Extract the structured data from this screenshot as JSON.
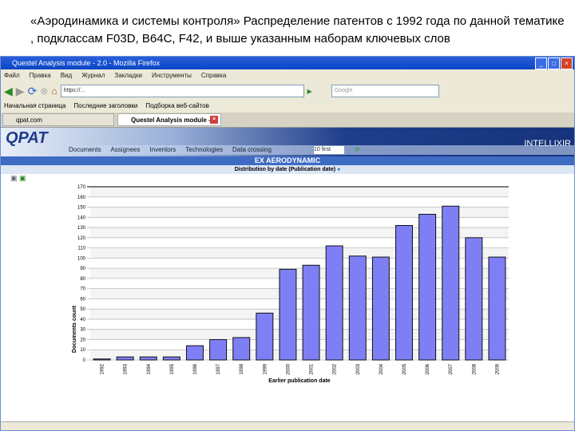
{
  "caption": "«Аэродинамика и системы контроля» Распределение патентов с 1992 года  по данной тематике , подклассам F03D, B64C, F42,  и выше указанным наборам ключевых слов",
  "browser": {
    "title": "Questel Analysis module - 2.0 - Mozilla Firefox",
    "menu": [
      "Файл",
      "Правка",
      "Вид",
      "Журнал",
      "Закладки",
      "Инструменты",
      "Справка"
    ],
    "url": "https://...",
    "search_placeholder": "Google",
    "bookmarks": [
      "Начальная страница",
      "Последние заголовки",
      "Подборка веб-сайтов"
    ],
    "tabs": [
      {
        "label": "qpat.com"
      },
      {
        "label": "Questel Analysis module - 2.0"
      }
    ]
  },
  "app": {
    "logo": "QPAT",
    "brand": "INTELLIXIR",
    "nav": [
      "Documents",
      "Assignees",
      "Inventors",
      "Technologies",
      "Data crossing"
    ],
    "select_value": "10 first",
    "section_title": "EX AERODYNAMIC",
    "subtitle": "Distribution by date (Publication date)"
  },
  "chart_data": {
    "type": "bar",
    "title": "Distribution by date (Publication date)",
    "xlabel": "Earlier publication date",
    "ylabel": "Documents count",
    "ylim": [
      0,
      170
    ],
    "yticks": [
      0,
      10,
      20,
      30,
      40,
      50,
      60,
      70,
      80,
      90,
      100,
      110,
      120,
      130,
      140,
      150,
      160,
      170
    ],
    "categories": [
      "1992",
      "1993",
      "1994",
      "1995",
      "1996",
      "1997",
      "1998",
      "1999",
      "2000",
      "2001",
      "2002",
      "2003",
      "2004",
      "2005",
      "2006",
      "2007",
      "2008",
      "2009"
    ],
    "values": [
      1,
      3,
      3,
      3,
      14,
      20,
      22,
      46,
      89,
      93,
      112,
      102,
      101,
      132,
      143,
      151,
      120,
      101
    ],
    "bar_color": "#7f7ff5",
    "grid": true
  }
}
